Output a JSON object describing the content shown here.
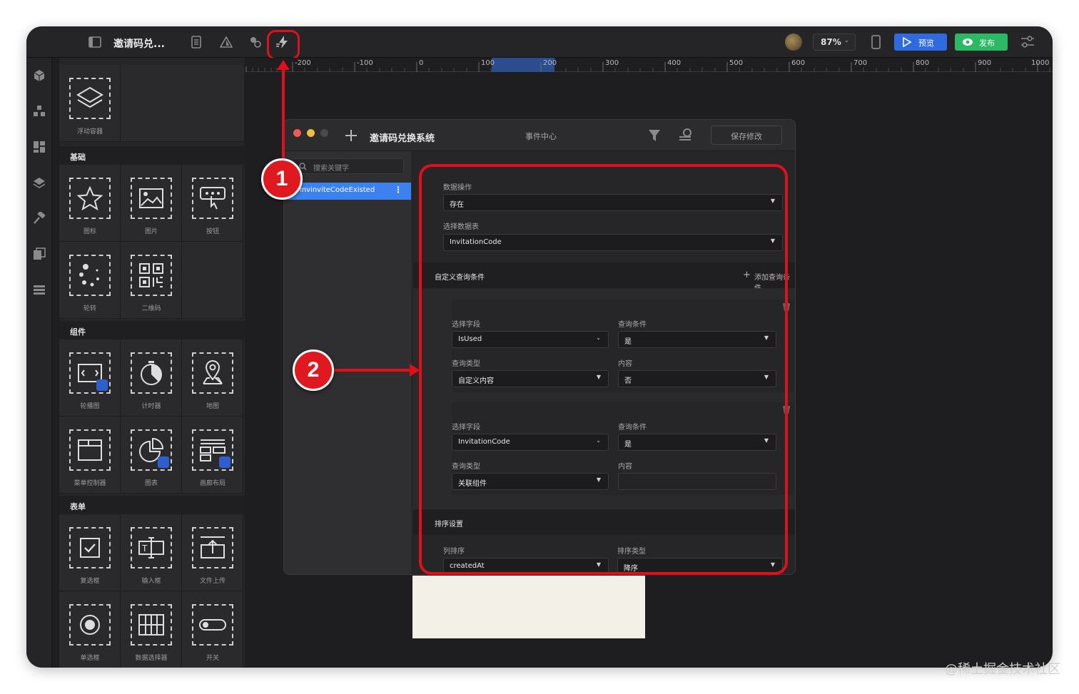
{
  "topbar": {
    "title": "邀请码兑...",
    "zoom": "87%",
    "preview_label": "预览",
    "publish_label": "发布"
  },
  "rail": {
    "icons": [
      "cube-icon",
      "components-icon",
      "widgets-icon",
      "layers-icon",
      "hammer-icon",
      "pages-icon",
      "list-icon"
    ]
  },
  "panel": {
    "top_items": [
      {
        "label": "浮动容器",
        "icon": "layers-icon"
      }
    ],
    "sections": [
      {
        "title": "基础",
        "items": [
          {
            "label": "图标",
            "icon": "star-icon"
          },
          {
            "label": "图片",
            "icon": "image-icon"
          },
          {
            "label": "按钮",
            "icon": "button-icon"
          },
          {
            "label": "轮转",
            "icon": "spinner-icon"
          },
          {
            "label": "二维码",
            "icon": "qrcode-icon"
          }
        ]
      },
      {
        "title": "组件",
        "items": [
          {
            "label": "轮播图",
            "icon": "carousel-icon"
          },
          {
            "label": "计时器",
            "icon": "timer-icon"
          },
          {
            "label": "地图",
            "icon": "map-pin-icon"
          },
          {
            "label": "菜单控制器",
            "icon": "menu-icon"
          },
          {
            "label": "图表",
            "icon": "pie-chart-icon"
          },
          {
            "label": "画廊布局",
            "icon": "gallery-icon"
          }
        ]
      },
      {
        "title": "表单",
        "items": [
          {
            "label": "复选框",
            "icon": "checkbox-icon"
          },
          {
            "label": "输入框",
            "icon": "text-input-icon"
          },
          {
            "label": "文件上传",
            "icon": "upload-icon"
          },
          {
            "label": "单选框",
            "icon": "radio-icon"
          },
          {
            "label": "数据选择器",
            "icon": "data-picker-icon"
          },
          {
            "label": "开关",
            "icon": "toggle-icon"
          }
        ]
      }
    ]
  },
  "ruler": {
    "labels": [
      "-200",
      "-100",
      "0",
      "100",
      "200",
      "300",
      "400",
      "500",
      "600",
      "700",
      "800",
      "900",
      "1000"
    ]
  },
  "dialog": {
    "title": "邀请码兑换系统",
    "center": "事件中心",
    "save_label": "保存修改",
    "search_placeholder": "搜索关键字",
    "selected_item": "invinviteCodeExisted",
    "data_op_label": "数据操作",
    "data_op_value": "存在",
    "table_label": "选择数据表",
    "table_value": "InvitationCode",
    "custom_query_label": "自定义查询条件",
    "add_query_label": "添加查询条件",
    "conditions": [
      {
        "field_label": "选择字段",
        "field_value": "IsUsed",
        "cond_label": "查询条件",
        "cond_value": "是",
        "type_label": "查询类型",
        "type_value": "自定义内容",
        "content_label": "内容",
        "content_value": "否"
      },
      {
        "field_label": "选择字段",
        "field_value": "InvitationCode",
        "cond_label": "查询条件",
        "cond_value": "是",
        "type_label": "查询类型",
        "type_value": "关联组件",
        "content_label": "内容",
        "content_value": ""
      }
    ],
    "sort_section": "排序设置",
    "sort_col_label": "列排序",
    "sort_col_value": "createdAt",
    "sort_type_label": "排序类型",
    "sort_type_value": "降序"
  },
  "markers": {
    "one": "1",
    "two": "2"
  },
  "colors": {
    "accent": "#e0101a",
    "preview": "#2f6be0",
    "publish": "#2bb964",
    "selection": "#3b82f0"
  },
  "watermark": "@稀土掘金技术社区"
}
